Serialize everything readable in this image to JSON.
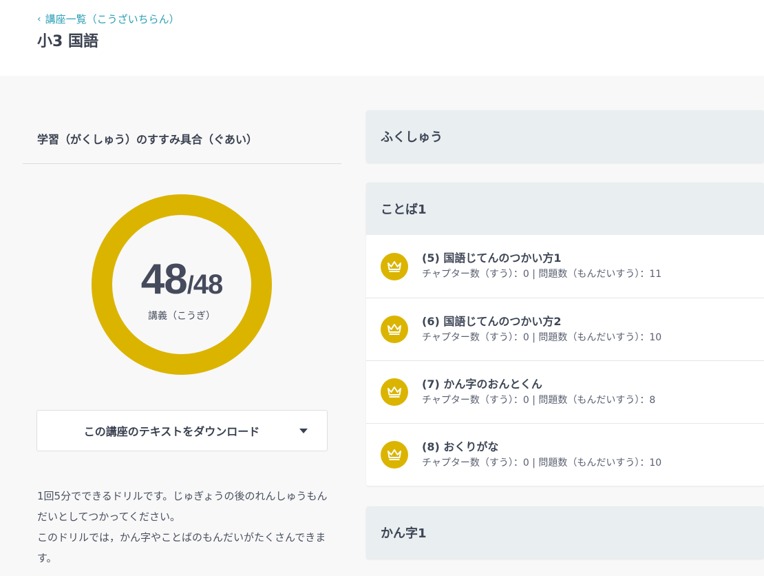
{
  "header": {
    "back_label": "講座一覧（こうざいちらん）",
    "title": "小3 国語"
  },
  "progress": {
    "title": "学習（がくしゅう）のすすみ具合（ぐあい）",
    "done": "48",
    "slash": "/",
    "total": "48",
    "unit": "講義（こうぎ）",
    "fraction": 1.0,
    "ring_color": "#dbb400"
  },
  "download": {
    "label": "この講座のテキストをダウンロード"
  },
  "description": {
    "line1": "1回5分でできるドリルです。じゅぎょうの後のれんしゅうもんだいとしてつかってください。",
    "line2": "このドリルでは，かん字やことばのもんだいがたくさんできます。"
  },
  "sections": [
    {
      "title": "ふくしゅう",
      "items": []
    },
    {
      "title": "ことば1",
      "items": [
        {
          "title": "(5) 国語じてんのつかい方1",
          "meta": "チャプター数（すう）：0 | 問題数（もんだいすう）：11",
          "icon": "crown-icon"
        },
        {
          "title": "(6) 国語じてんのつかい方2",
          "meta": "チャプター数（すう）：0 | 問題数（もんだいすう）：10",
          "icon": "crown-icon"
        },
        {
          "title": "(7) かん字のおんとくん",
          "meta": "チャプター数（すう）：0 | 問題数（もんだいすう）：8",
          "icon": "crown-icon"
        },
        {
          "title": "(8) おくりがな",
          "meta": "チャプター数（すう）：0 | 問題数（もんだいすう）：10",
          "icon": "crown-icon"
        }
      ]
    },
    {
      "title": "かん字1",
      "items": []
    }
  ],
  "colors": {
    "accent_link": "#2a9fb6",
    "badge": "#dbb400",
    "section_header_bg": "#e9eef0"
  }
}
